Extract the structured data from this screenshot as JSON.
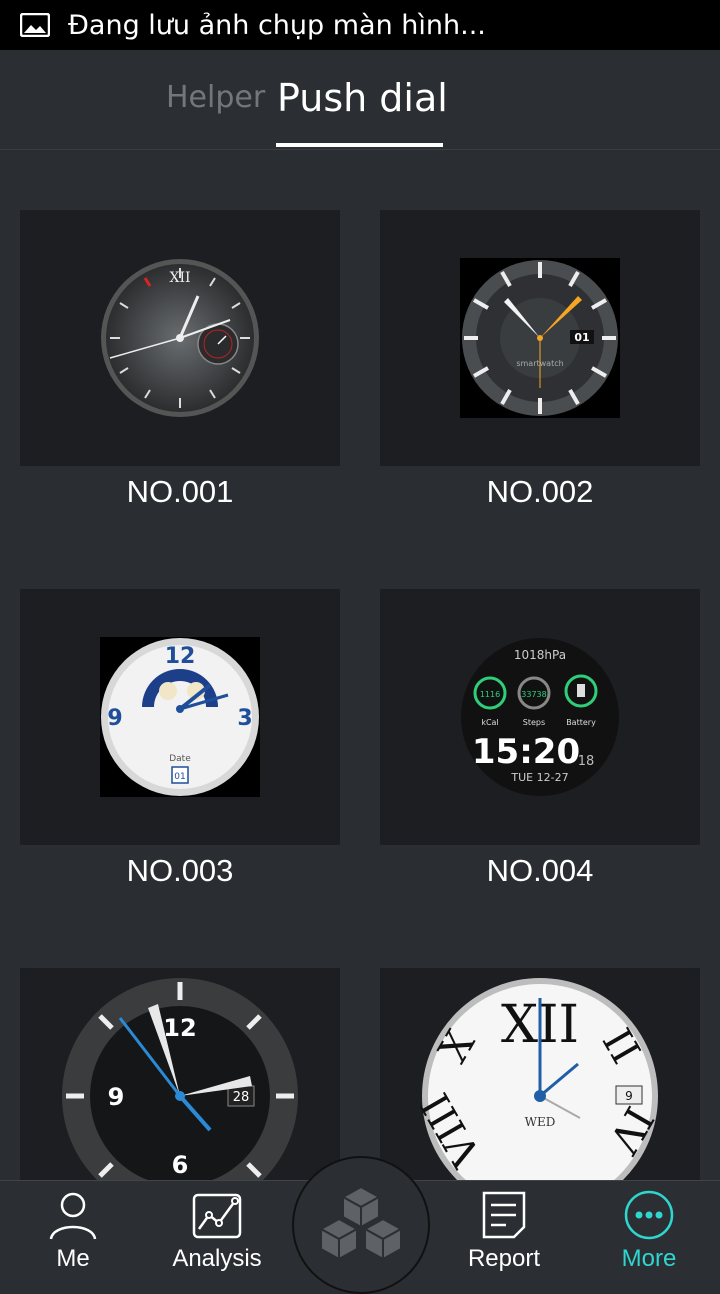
{
  "status_bar": {
    "text": "Đang lưu ảnh chụp màn hình..."
  },
  "tabs": {
    "helper": "Helper",
    "push_dial": "Push dial"
  },
  "dials": [
    {
      "label": "NO.001"
    },
    {
      "label": "NO.002",
      "brand_text": "smartwatch",
      "date": "01"
    },
    {
      "label": "NO.003",
      "n12": "12",
      "n9": "9",
      "n3": "3",
      "date_label": "Date",
      "date": "01"
    },
    {
      "label": "NO.004",
      "pressure": "1018hPa",
      "kcal_value": "1116",
      "kcal_label": "kCal",
      "steps_value": "33738",
      "steps_label": "Steps",
      "battery_label": "Battery",
      "time": "15:20",
      "seconds": "18",
      "date_line": "TUE  12-27"
    },
    {
      "n12": "12",
      "n9": "9",
      "n6": "6",
      "date": "28"
    },
    {
      "day": "WED",
      "date": "9"
    }
  ],
  "nav": {
    "me": "Me",
    "analysis": "Analysis",
    "report": "Report",
    "more": "More"
  },
  "colors": {
    "accent": "#2fd6d0"
  }
}
